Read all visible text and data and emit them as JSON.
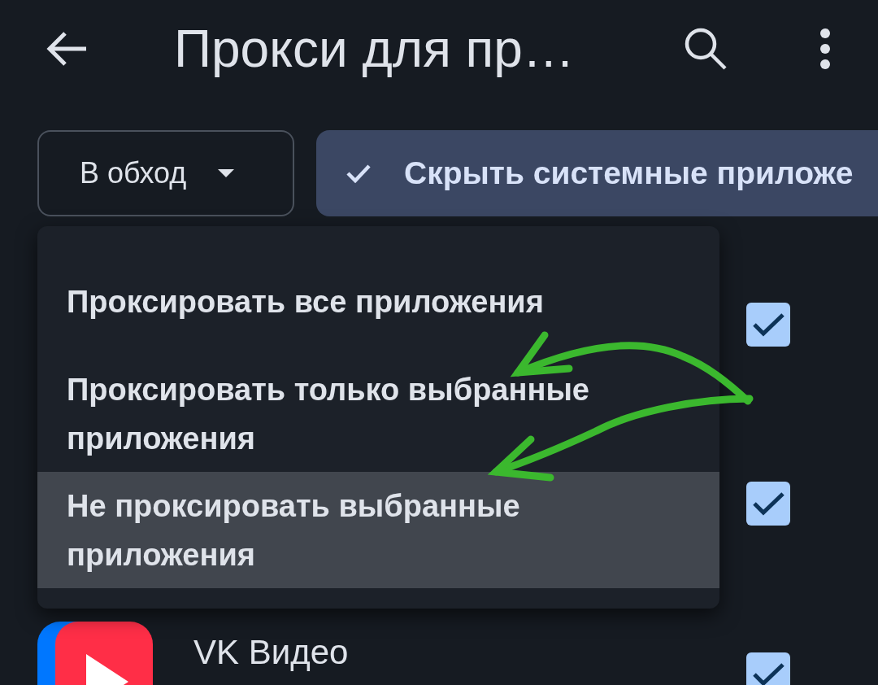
{
  "app_bar": {
    "title": "Прокси для пр…"
  },
  "filters": {
    "mode_dropdown": {
      "label": "В обход"
    },
    "hide_system_chip": {
      "label": "Скрыть системные приложе",
      "selected": true
    }
  },
  "app_rows": [
    {
      "checked": true
    },
    {
      "checked": true
    },
    {
      "name": "VK Видео",
      "checked": true
    }
  ],
  "mode_menu": {
    "items": [
      {
        "label": "Проксировать все приложения",
        "selected": false
      },
      {
        "label": "Проксировать только выбранные приложения",
        "selected": false
      },
      {
        "label": "Не проксировать выбранные приложения",
        "selected": true
      }
    ]
  }
}
